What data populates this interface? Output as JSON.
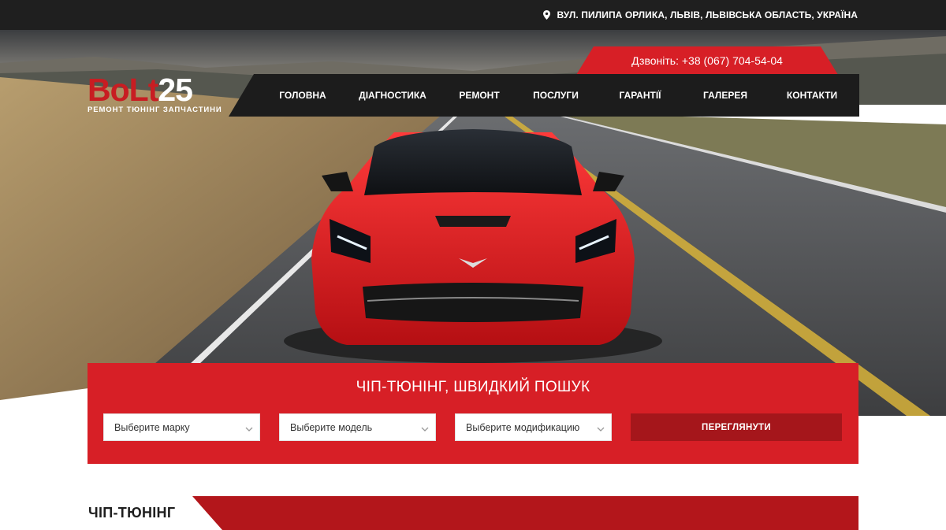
{
  "topbar": {
    "address": "ВУЛ. ПИЛИПА ОРЛИКА, ЛЬВІВ, ЛЬВІВСЬКА ОБЛАСТЬ, УКРАЇНА",
    "icon": "map-pin-icon"
  },
  "logo": {
    "brand_part1": "BoLt",
    "brand_part2": "25",
    "tagline": "РЕМОНТ  ТЮНІНГ  ЗАПЧАСТИНИ"
  },
  "call": {
    "label": "Дзвоніть: +38 (067) 704-54-04"
  },
  "nav": {
    "items": [
      {
        "label": "ГОЛОВНА"
      },
      {
        "label": "ДІАГНОСТИКА"
      },
      {
        "label": "РЕМОНТ"
      },
      {
        "label": "ПОСЛУГИ"
      },
      {
        "label": "ГАРАНТІЇ"
      },
      {
        "label": "ГАЛЕРЕЯ"
      },
      {
        "label": "КОНТАКТИ"
      }
    ]
  },
  "search": {
    "title": "ЧІП-ТЮНІНГ, ШВИДКИЙ ПОШУК",
    "make": "Выберите марку",
    "model": "Выберите модель",
    "modification": "Выберите модификацию",
    "button": "ПЕРЕГЛЯНУТИ"
  },
  "section": {
    "title": "ЧІП-ТЮНІНГ"
  },
  "colors": {
    "accent": "#d71f26",
    "accent_dark": "#a5161b",
    "dark": "#1f1f1f"
  }
}
